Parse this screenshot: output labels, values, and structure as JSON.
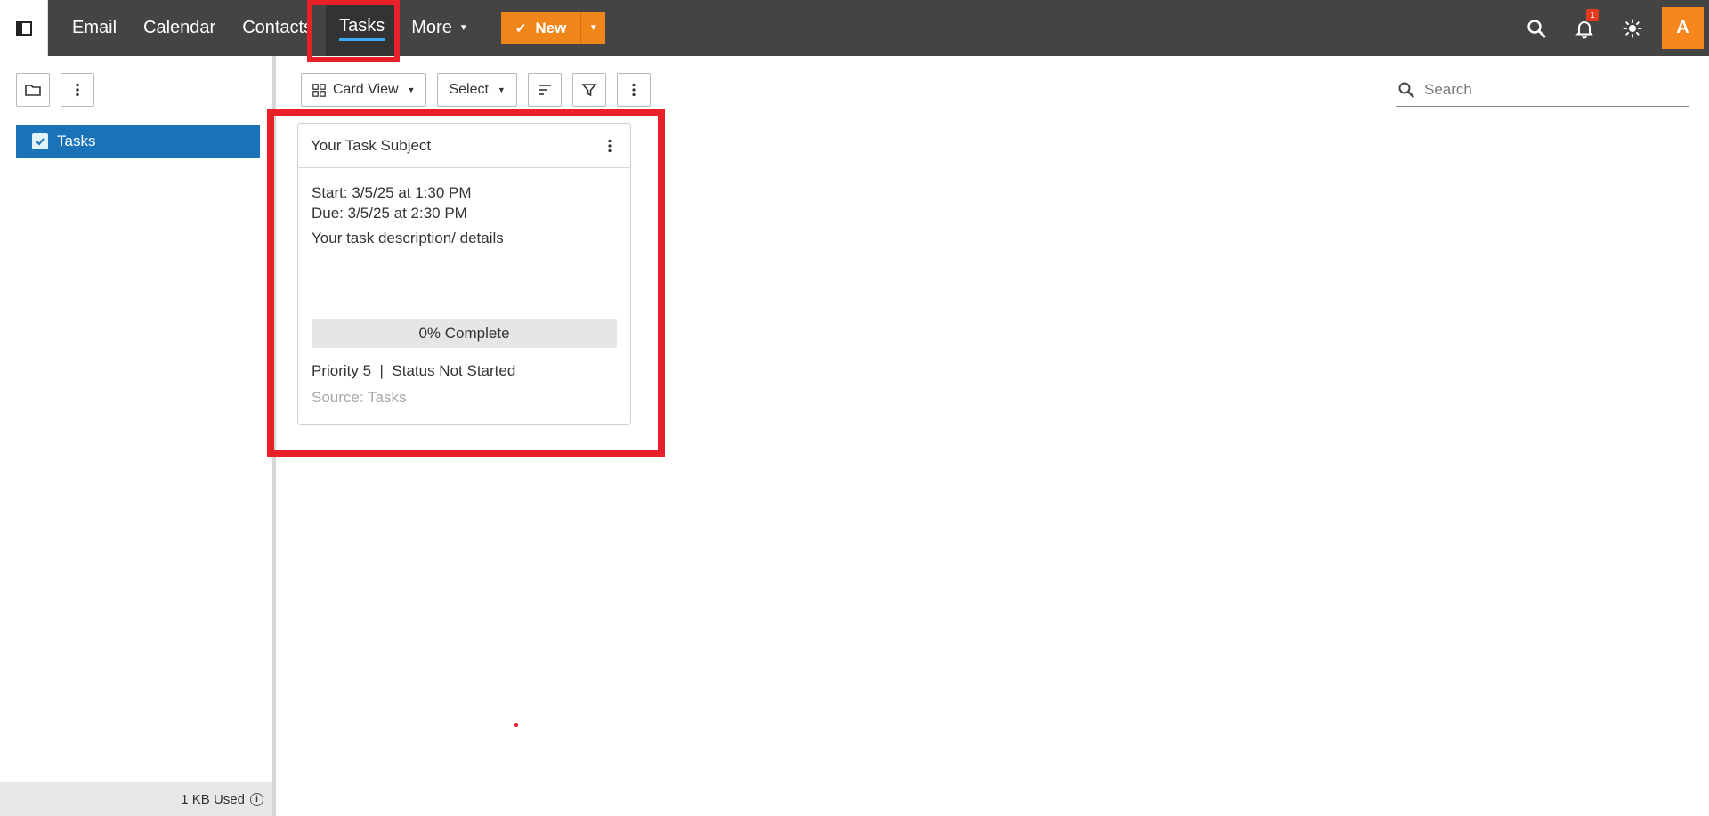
{
  "nav": {
    "items": [
      {
        "label": "Email"
      },
      {
        "label": "Calendar"
      },
      {
        "label": "Contacts"
      },
      {
        "label": "Tasks",
        "active": true
      },
      {
        "label": "More"
      }
    ],
    "new_label": "New"
  },
  "header": {
    "notification_count": "1",
    "avatar_initial": "A"
  },
  "sidebar": {
    "folders": [
      {
        "label": "Tasks",
        "checked": true
      }
    ],
    "storage_text": "1 KB Used"
  },
  "toolbar": {
    "view_label": "Card View",
    "select_label": "Select"
  },
  "search": {
    "placeholder": "Search"
  },
  "task_card": {
    "subject": "Your Task Subject",
    "start": "Start: 3/5/25 at 1:30 PM",
    "due": "Due: 3/5/25 at 2:30 PM",
    "description": "Your task description/ details",
    "progress_percent": 0,
    "progress_text": "0% Complete",
    "meta": "Priority 5  |  Status Not Started",
    "source": "Source: Tasks"
  },
  "colors": {
    "topbar": "#444444",
    "accent_orange": "#f0861a",
    "folder_active": "#1a72b8",
    "highlight_red": "#e8202a",
    "underline_blue": "#3fa9f5"
  }
}
